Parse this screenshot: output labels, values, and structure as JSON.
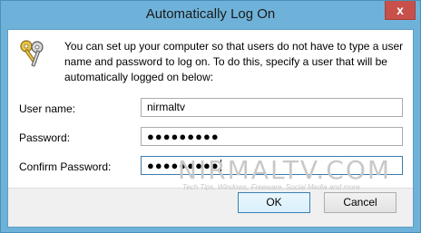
{
  "window": {
    "title": "Automatically Log On",
    "close_glyph": "x"
  },
  "header": {
    "icon": "keys-icon",
    "description": "You can set up your computer so that users do not have to type a user name and password to log on. To do this, specify a user that will be automatically logged on below:"
  },
  "form": {
    "user_name_label": "User name:",
    "user_name_value": "nirmaltv",
    "password_label": "Password:",
    "password_value": "●●●●●●●●●",
    "confirm_label": "Confirm Password:",
    "confirm_value": "●●●●●●●●●"
  },
  "watermark": {
    "text": "NIRMALTV.COM",
    "tagline": "Tech Tips, Windows, Freeware, Social Media and more"
  },
  "buttons": {
    "ok": "OK",
    "cancel": "Cancel"
  },
  "colors": {
    "frame": "#6fb2d9",
    "close": "#c7504a",
    "focus": "#3d7bad"
  }
}
